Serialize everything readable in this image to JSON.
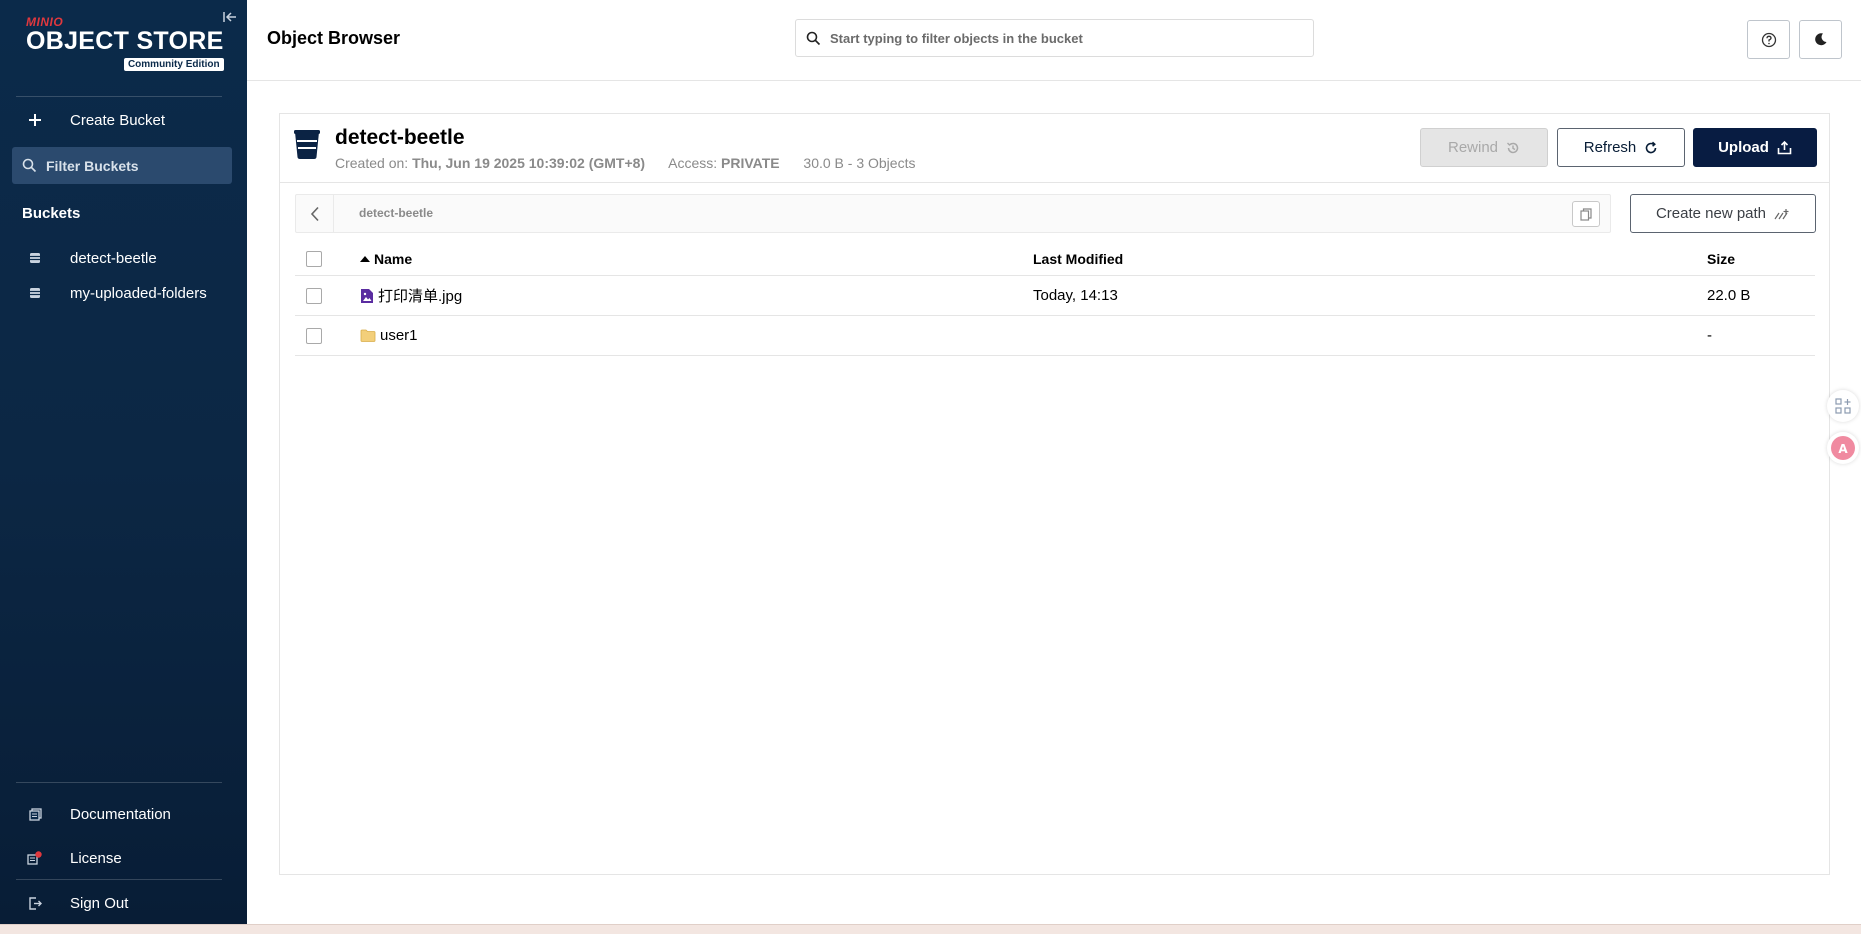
{
  "sidebar": {
    "logo_brand": "MINIO",
    "logo_product": "OBJECT STORE",
    "logo_edition": "Community Edition",
    "create_bucket_label": "Create Bucket",
    "filter_buckets_placeholder": "Filter Buckets",
    "buckets_title": "Buckets",
    "buckets": [
      {
        "label": "detect-beetle"
      },
      {
        "label": "my-uploaded-folders"
      }
    ],
    "documentation_label": "Documentation",
    "license_label": "License",
    "sign_out_label": "Sign Out"
  },
  "header": {
    "title": "Object Browser",
    "search_placeholder": "Start typing to filter objects in the bucket"
  },
  "bucket": {
    "name": "detect-beetle",
    "created_label": "Created on:",
    "created_value": "Thu, Jun 19 2025 10:39:02 (GMT+8)",
    "access_label": "Access:",
    "access_value": "PRIVATE",
    "summary": "30.0 B - 3 Objects",
    "rewind_label": "Rewind",
    "refresh_label": "Refresh",
    "upload_label": "Upload"
  },
  "breadcrumb": {
    "path": "detect-beetle",
    "create_new_path_label": "Create new path"
  },
  "table": {
    "columns": {
      "name": "Name",
      "modified": "Last Modified",
      "size": "Size"
    },
    "rows": [
      {
        "name": "打印清单.jpg",
        "type": "image-file-icon",
        "modified": "Today, 14:13",
        "size": "22.0 B"
      },
      {
        "name": "user1",
        "type": "folder-icon",
        "modified": "",
        "size": "-"
      }
    ]
  },
  "colors": {
    "sidebar_bg": "#0b2a4a",
    "brand_red": "#e0383e",
    "upload_bg": "#081c42",
    "file_icon": "#5a2ca0",
    "folder_icon": "#f3cf7a",
    "license_badge": "#e0383e"
  }
}
